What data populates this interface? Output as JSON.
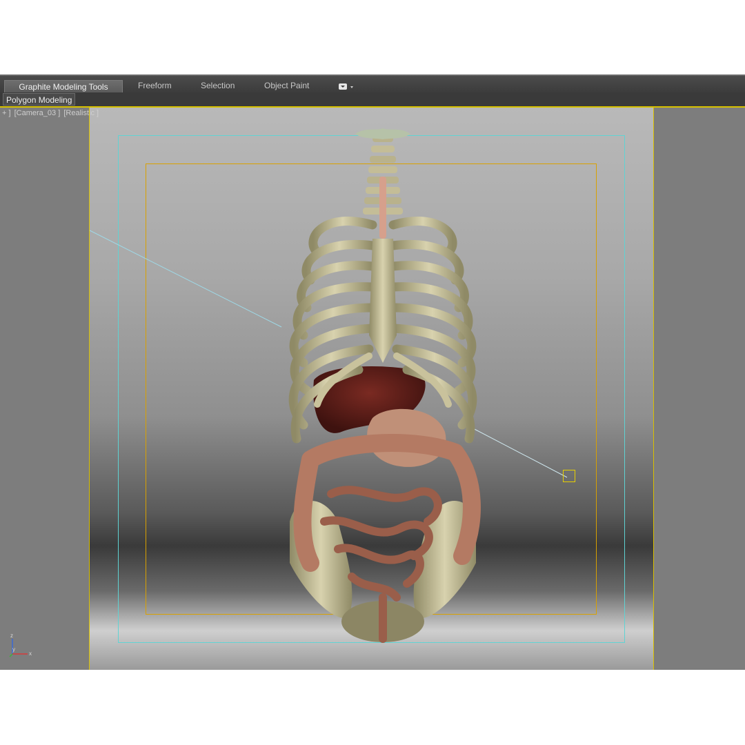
{
  "ribbon": {
    "tabs": [
      {
        "label": "Graphite Modeling Tools",
        "active": true
      },
      {
        "label": "Freeform",
        "active": false
      },
      {
        "label": "Selection",
        "active": false
      },
      {
        "label": "Object Paint",
        "active": false
      }
    ],
    "panel_label": "Polygon Modeling"
  },
  "viewport": {
    "label_plus": "+ ]",
    "label_camera": "[Camera_03 ]",
    "label_shading": "[Realistic ]"
  },
  "gizmo": {
    "z": "z",
    "y": "y",
    "x": "x"
  },
  "colors": {
    "accent_yellow": "#d9c000",
    "safe_frame_cyan": "#5fd3d3",
    "safe_frame_orange": "#d9a100"
  }
}
